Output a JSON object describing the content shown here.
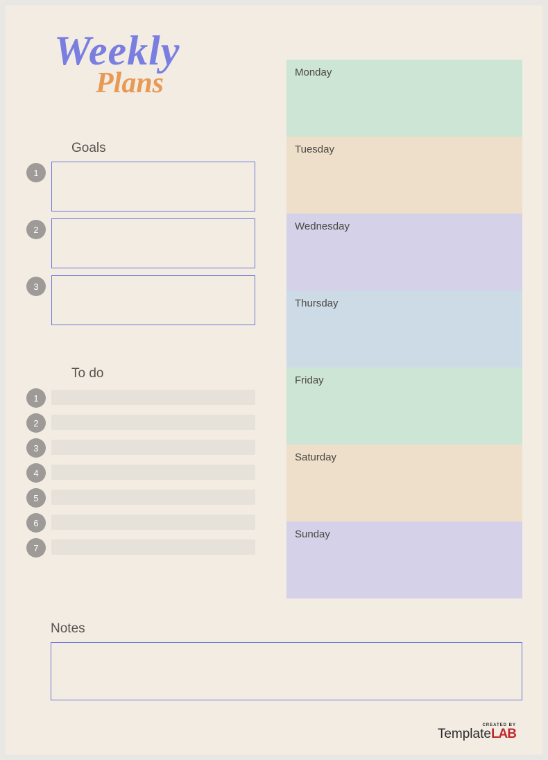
{
  "title": {
    "line1": "Weekly",
    "line2": "Plans"
  },
  "goals": {
    "heading": "Goals",
    "items": [
      {
        "num": "1",
        "value": ""
      },
      {
        "num": "2",
        "value": ""
      },
      {
        "num": "3",
        "value": ""
      }
    ]
  },
  "todo": {
    "heading": "To do",
    "items": [
      {
        "num": "1",
        "value": ""
      },
      {
        "num": "2",
        "value": ""
      },
      {
        "num": "3",
        "value": ""
      },
      {
        "num": "4",
        "value": ""
      },
      {
        "num": "5",
        "value": ""
      },
      {
        "num": "6",
        "value": ""
      },
      {
        "num": "7",
        "value": ""
      }
    ]
  },
  "days": [
    {
      "label": "Monday",
      "color": "#cce5d4"
    },
    {
      "label": "Tuesday",
      "color": "#eddfc9"
    },
    {
      "label": "Wednesday",
      "color": "#d4d1e8"
    },
    {
      "label": "Thursday",
      "color": "#cddbe6"
    },
    {
      "label": "Friday",
      "color": "#cce5d4"
    },
    {
      "label": "Saturday",
      "color": "#eddfc9"
    },
    {
      "label": "Sunday",
      "color": "#d4d1e8"
    }
  ],
  "notes": {
    "heading": "Notes",
    "value": ""
  },
  "footer": {
    "prefix": "CREATED BY",
    "brand1": "Template",
    "brand2": "LAB"
  }
}
